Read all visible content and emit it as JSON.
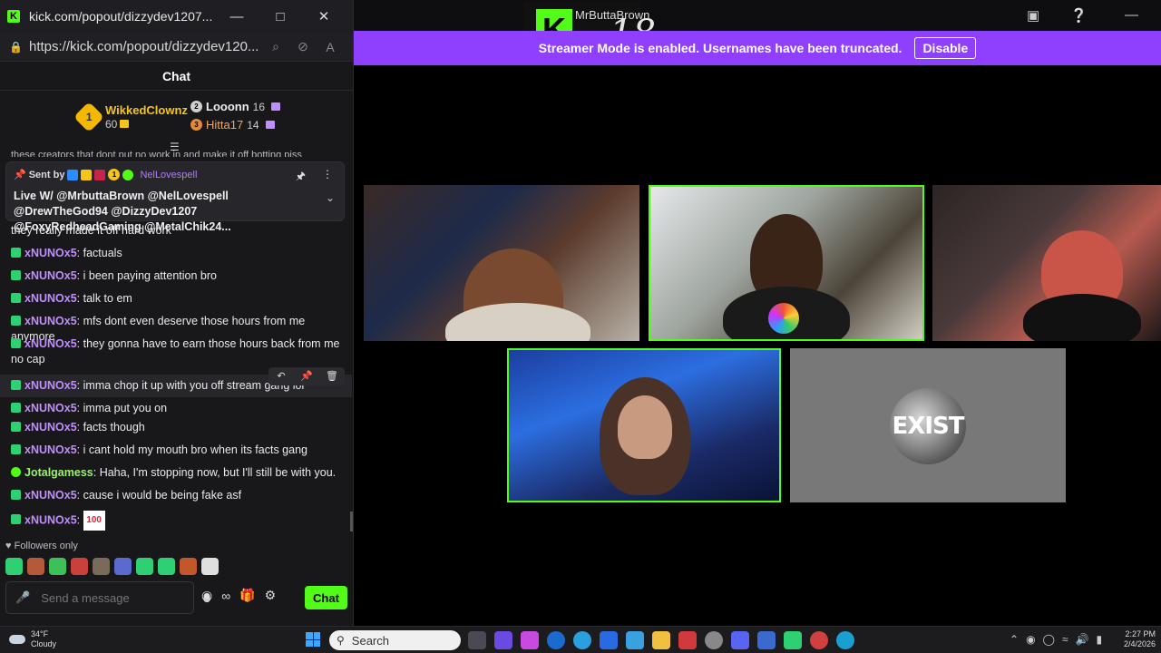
{
  "window": {
    "title": "kick.com/popout/dizzydev1207...",
    "url": "https://kick.com/popout/dizzydev120...",
    "chat_header": "Chat"
  },
  "leaderboard": {
    "first": {
      "rank": "1",
      "name": "WikkedClownz",
      "count": "60"
    },
    "second": {
      "name": "Looonn",
      "count": "16"
    },
    "third": {
      "name": "Hitta17",
      "count": "14"
    }
  },
  "truncated_line": "these creators that dont put no work in and make it off botting piss",
  "pinned": {
    "sent_by_label": "Sent by",
    "badge_count": "1",
    "author": "NelLovespell",
    "text": "Live W/ @MrbuttaBrown @NelLovespell @DrewTheGod94 @DizzyDev1207 @FoxyRedheadGaming @MetalChik24..."
  },
  "messages": [
    {
      "user": "",
      "text": "they really made it off hard work"
    },
    {
      "user": "xNUNOx5",
      "text": "factuals"
    },
    {
      "user": "xNUNOx5",
      "text": "i been paying attention bro"
    },
    {
      "user": "xNUNOx5",
      "text": "talk to em"
    },
    {
      "user": "xNUNOx5",
      "text": "mfs dont even deserve those hours from me anymore"
    },
    {
      "user": "xNUNOx5",
      "text": "they gonna have to earn those hours back from me no cap"
    },
    {
      "user": "xNUNOx5",
      "text": "imma chop it up with you off stream gang lol"
    },
    {
      "user": "xNUNOx5",
      "text": "imma put you on"
    },
    {
      "user": "xNUNOx5",
      "text": "facts though"
    },
    {
      "user": "xNUNOx5",
      "text": "i cant hold my mouth bro when its facts gang"
    },
    {
      "user": "Jotalgamess",
      "text": "Haha, I'm stopping now, but I'll still be with you."
    },
    {
      "user": "xNUNOx5",
      "text": "cause i would be being fake asf"
    },
    {
      "user": "xNUNOx5",
      "text": "",
      "emote": "100"
    }
  ],
  "followers_only": "Followers only",
  "composer": {
    "placeholder": "Send a message",
    "chat_button": "Chat"
  },
  "stream": {
    "streamer": "MrButtaBrown",
    "age_rating": "18",
    "banner_text": "Streamer Mode is enabled. Usernames have been truncated.",
    "disable_button": "Disable",
    "cam5_logo": "EXIST"
  },
  "taskbar": {
    "temp": "34°F",
    "condition": "Cloudy",
    "search": "Search",
    "time": "2:27 PM",
    "date": "2/4/2026"
  },
  "colors": {
    "kick_green": "#53fc18",
    "banner_purple": "#8f40ff",
    "username_purple": "#c18dff"
  }
}
